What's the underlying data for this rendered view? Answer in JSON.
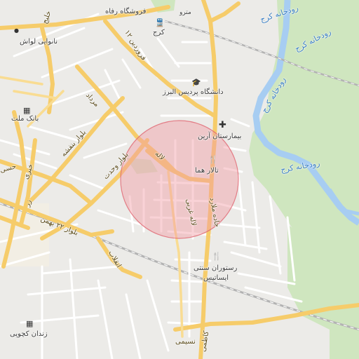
{
  "colors": {
    "background": "#ecebe8",
    "park": "#cfe6bf",
    "water": "#a7cdf2",
    "major_road": "#f6cc6a",
    "minor_road": "#ffffff",
    "rail": "#a8a8a8",
    "circle_fill": "#f19ca4",
    "circle_stroke": "#e06672"
  },
  "labels": {
    "store_refah": "فروشگاه رفاه",
    "karaj_station": "کرج",
    "metro": "مترو",
    "river_1": "رودخانه کرج",
    "river_2": "رودخانه کرج",
    "river_3": "رودخانه کرج",
    "river_4": "رودخانه کرج",
    "bakery": "نانوایی لواش",
    "bank_mellat": "بانک ملت",
    "alborz_campus": "دانشگاه پردیس البرز",
    "arian_hospital": "بیمارستان آرین",
    "homa_hall": "تالار هما",
    "city_restaurant_1": "رستوران سنتی",
    "city_restaurant_2": "ایساتیس",
    "kachui_prison": "زندان کچویی",
    "road_mordad": "مرداد",
    "road_farvardin": "فروردین ۱۲",
    "road_golbahar": "بلوار بنفشه",
    "road_vahdat": "بلوار وحدت",
    "road_bahman": "بلوار ۲۲ بهمن",
    "road_enghelab": "انقلاب",
    "road_taleghani": "جاده ملارد",
    "road_beheshti": "لاله غربی",
    "road_laleh": "لاله",
    "road_nasimi": "نسیمی",
    "road_kazemi": "کاظمی",
    "road_kheyri": "خیری",
    "road_hesam": "حسی",
    "road_zaer": "زر",
    "road_khalij": "خلیج"
  },
  "icons": {
    "train": "train-icon",
    "graduation": "graduation-cap-icon",
    "bank": "bank-icon",
    "hospital": "hospital-cross-icon",
    "restaurant": "fork-knife-icon",
    "prison": "building-icon"
  }
}
